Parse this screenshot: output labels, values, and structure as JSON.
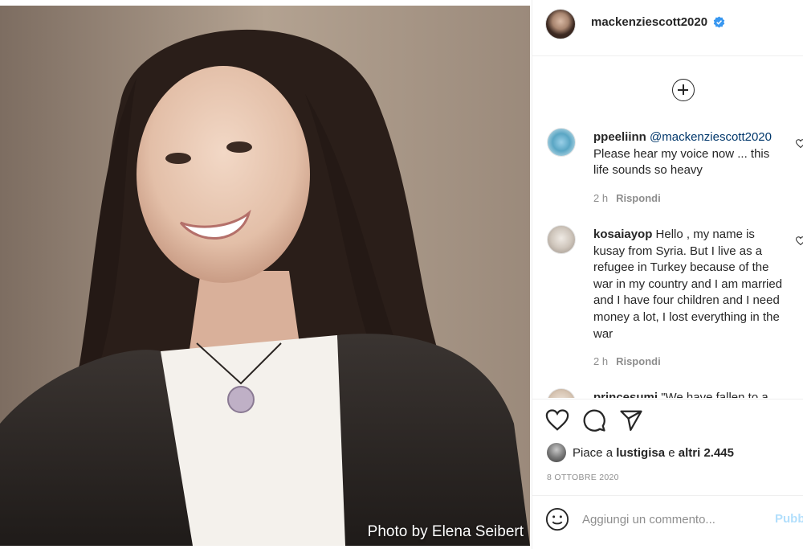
{
  "photo": {
    "credit": "Photo by Elena Seibert"
  },
  "header": {
    "username": "mackenziescott2020",
    "verified": true,
    "verified_color": "#3897f0"
  },
  "add_more_icon": "plus-circle-icon",
  "comments": [
    {
      "username": "ppeeliinn",
      "mention": "@mackenziescott2020",
      "text": "Please hear my voice now ... this life sounds so heavy",
      "time": "2 h",
      "reply_label": "Rispondi"
    },
    {
      "username": "kosaiayop",
      "text": "Hello , my name is kusay from Syria. But I live as a refugee in Turkey because of the war in my country and I am married and I have four children and I need money a lot, I lost everything in the war",
      "time": "2 h",
      "reply_label": "Rispondi"
    },
    {
      "username": "princesumi",
      "text": "\"We have fallen to a"
    }
  ],
  "actions": {
    "like_icon": "heart-icon",
    "comment_icon": "comment-bubble-icon",
    "share_icon": "paper-plane-icon"
  },
  "likes": {
    "prefix": "Piace a",
    "user": "lustigisa",
    "connector": "e",
    "others": "altri 2.445"
  },
  "date": "8 OTTOBRE 2020",
  "comment_box": {
    "placeholder": "Aggiungi un commento...",
    "publish_label": "Pubblica",
    "emoji_icon": "smiley-icon"
  }
}
